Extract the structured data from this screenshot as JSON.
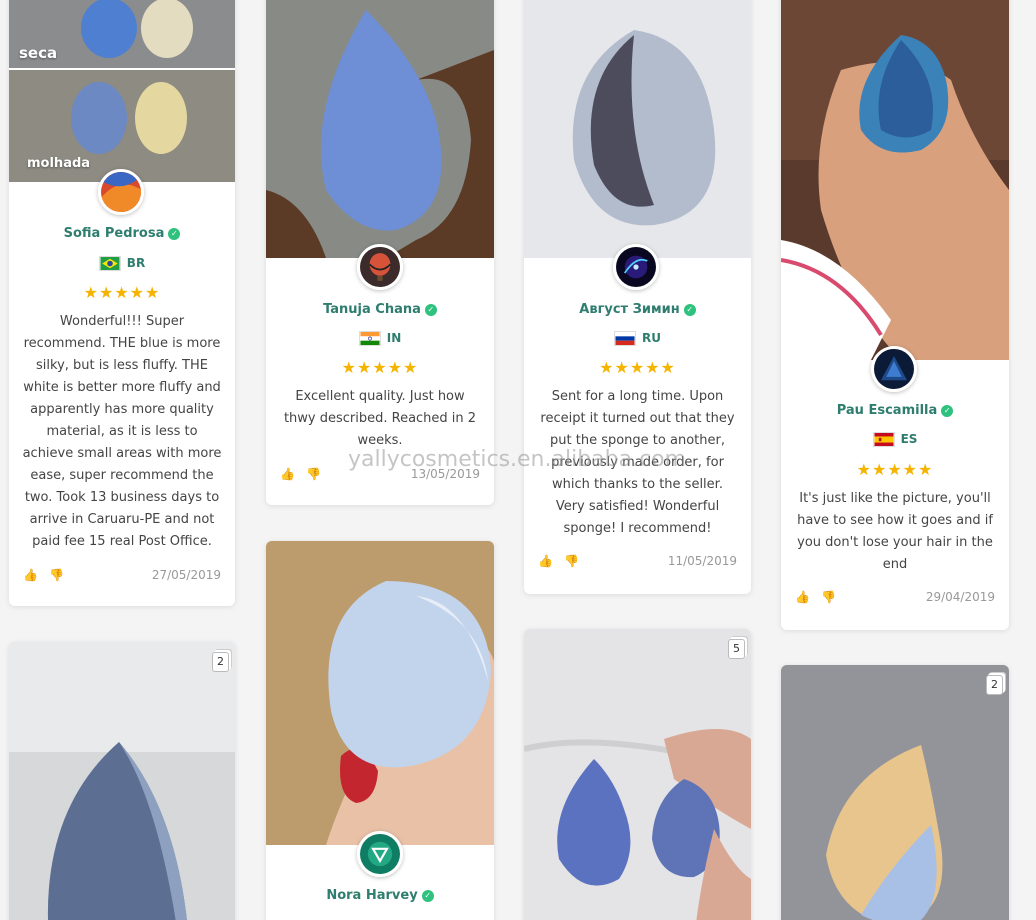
{
  "watermark": "yallycosmetics.en.alibaba.com",
  "reviews": [
    {
      "name": "Sofia Pedrosa",
      "country": "BR",
      "stars": "★★★★★",
      "rating": 5,
      "text": "Wonderful!!! Super recommend. THE blue is more silky, but is less fluffy. THE white is better more fluffy and apparently has more quality material, as it is less to achieve small areas with more ease, super recommend the two. Took 13 business days to arrive in Caruaru-PE and not paid fee 15 real Post Office.",
      "date": "27/05/2019",
      "photo_labels": [
        "seca",
        "molhada"
      ]
    },
    {
      "name": "Tanuja Chana",
      "country": "IN",
      "stars": "★★★★★",
      "rating": 5,
      "text": "Excellent quality. Just how thwy described. Reached in 2 weeks.",
      "date": "13/05/2019"
    },
    {
      "name": "Август Зимин",
      "country": "RU",
      "stars": "★★★★★",
      "rating": 5,
      "text": "Sent for a long time. Upon receipt it turned out that they put the sponge to another, previously made order, for which thanks to the seller. Very satisfied! Wonderful sponge! I recommend!",
      "date": "11/05/2019"
    },
    {
      "name": "Pau Escamilla",
      "country": "ES",
      "stars": "★★★★★",
      "rating": 5,
      "text": "It's just like the picture, you'll have to see how it goes and if you don't lose your hair in the end",
      "date": "29/04/2019"
    },
    {
      "name": "Nora Harvey"
    }
  ],
  "photo_counts": {
    "col1": "2",
    "col3": "5",
    "col4": "2"
  },
  "icons": {
    "thumb_up": "👍",
    "thumb_down": "👎",
    "verified": "✓"
  }
}
